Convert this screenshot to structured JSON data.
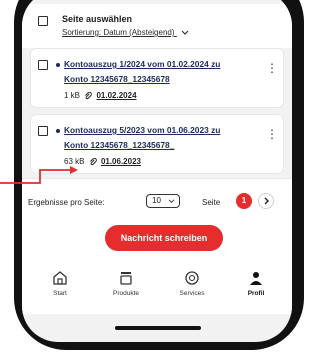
{
  "select_bar": {
    "label": "Seite auswählen",
    "sort_label": "Sortierung: Datum (Absteigend)",
    "sort_icon": "chevron-down-icon"
  },
  "documents": [
    {
      "title_line1": "Kontoauszug 1/2024 vom 01.02.2024 zu",
      "title_line2": "Konto 12345678_12345678",
      "size": "1 kB",
      "date": "01.02.2024",
      "unread": true
    },
    {
      "title_line1": "Kontoauszug 5/2023 vom 01.06.2023 zu",
      "title_line2": "Konto 12345678_12345678_",
      "size": "63 kB",
      "date": "01.06.2023",
      "unread": true
    }
  ],
  "pagination": {
    "per_page_label": "Ergebnisse pro Seite:",
    "per_page_value": "10",
    "page_label": "Seite",
    "current_page": "1"
  },
  "cta": {
    "label": "Nachricht schreiben"
  },
  "bottom_nav": [
    {
      "label": "Start",
      "icon": "home-icon"
    },
    {
      "label": "Produkte",
      "icon": "stack-icon"
    },
    {
      "label": "Services",
      "icon": "services-icon"
    },
    {
      "label": "Profil",
      "icon": "person-icon",
      "active": true
    }
  ],
  "colors": {
    "accent": "#e52d2d",
    "link": "#1d2a5b",
    "annotation": "#e52d2d"
  }
}
